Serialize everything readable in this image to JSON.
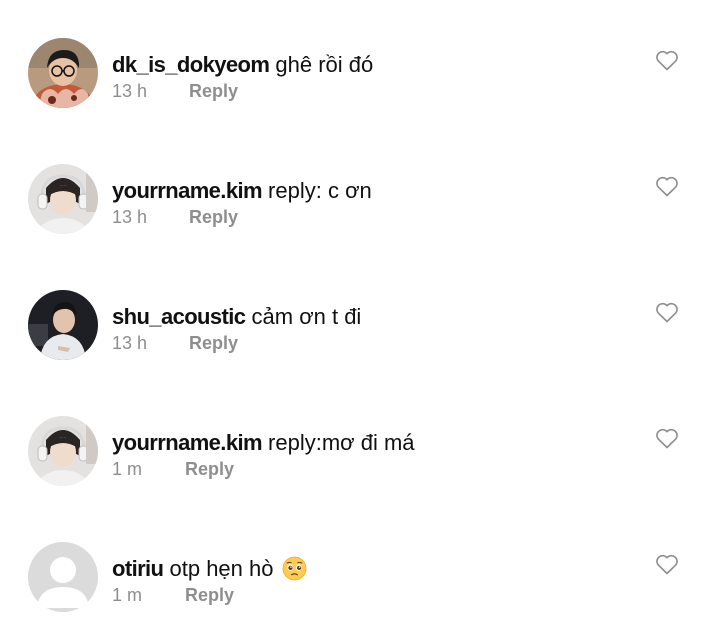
{
  "comments": [
    {
      "username": "dk_is_dokyeom",
      "text": " ghê rồi đó",
      "time": "13 h",
      "reply_label": "Reply",
      "like_icon": "heart-outline-icon",
      "avatar_icon": "profile-photo"
    },
    {
      "username": "yourrname.kim",
      "text": " reply: c ơn",
      "time": "13 h",
      "reply_label": "Reply",
      "like_icon": "heart-outline-icon",
      "avatar_icon": "profile-photo"
    },
    {
      "username": "shu_acoustic",
      "text": " cảm ơn t đi",
      "time": "13 h",
      "reply_label": "Reply",
      "like_icon": "heart-outline-icon",
      "avatar_icon": "profile-photo"
    },
    {
      "username": "yourrname.kim",
      "text": " reply:mơ đi má",
      "time": "1 m",
      "reply_label": "Reply",
      "like_icon": "heart-outline-icon",
      "avatar_icon": "profile-photo"
    },
    {
      "username": "otiriu",
      "text": " otp hẹn hò ",
      "emoji": "pleading-face-emoji",
      "time": "1 m",
      "reply_label": "Reply",
      "like_icon": "heart-outline-icon",
      "avatar_icon": "default-avatar-icon"
    }
  ],
  "colors": {
    "text": "#111111",
    "secondary": "#8e8e8e",
    "background": "#ffffff",
    "default_avatar": "#dbdbdb"
  }
}
